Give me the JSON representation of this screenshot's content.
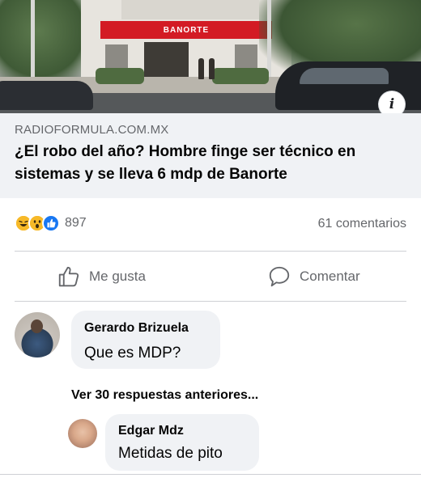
{
  "post": {
    "info_badge": "i",
    "image_sign": "BANORTE",
    "link_source": "RADIOFORMULA.COM.MX",
    "headline": "¿El robo del año? Hombre finge ser técnico en sistemas y se lleva 6 mdp de Banorte",
    "reaction_count": "897",
    "comments_count": "61 comentarios",
    "reactions": [
      "haha",
      "wow",
      "like"
    ]
  },
  "actions": {
    "like_label": "Me gusta",
    "comment_label": "Comentar"
  },
  "comments": [
    {
      "author": "Gerardo Brizuela",
      "text": "Que es MDP?"
    }
  ],
  "view_more_label": "Ver 30 respuestas anteriores...",
  "replies": [
    {
      "author": "Edgar Mdz",
      "text": "Metidas de pito"
    }
  ],
  "colors": {
    "bank_red": "#d31b24",
    "like_blue": "#1877f2",
    "reaction_yellow": "#f7b928",
    "secondary_text": "#65676b",
    "bubble_bg": "#f0f2f5"
  }
}
